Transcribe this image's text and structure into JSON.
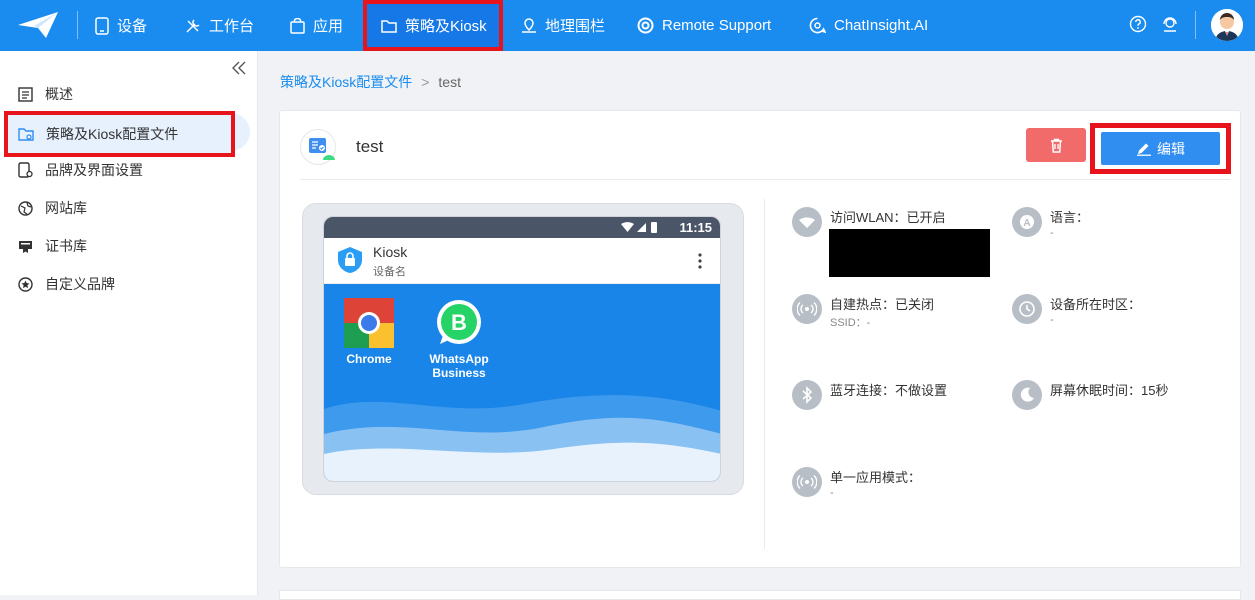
{
  "topnav": {
    "items": [
      {
        "label": "设备",
        "icon": "tablet-icon"
      },
      {
        "label": "工作台",
        "icon": "tools-icon"
      },
      {
        "label": "应用",
        "icon": "app-bag-icon"
      },
      {
        "label": "策略及Kiosk",
        "icon": "folder-icon"
      },
      {
        "label": "地理围栏",
        "icon": "map-pin-icon"
      },
      {
        "label": "Remote Support",
        "icon": "lifebuoy-icon"
      },
      {
        "label": "ChatInsight.AI",
        "icon": "chat-ai-icon"
      }
    ],
    "active_index": 3,
    "accent": "#1a8cf0",
    "highlight": "#e8141c"
  },
  "sidebar": {
    "items": [
      {
        "label": "概述",
        "icon": "overview-icon"
      },
      {
        "label": "策略及Kiosk配置文件",
        "icon": "folder-config-icon"
      },
      {
        "label": "品牌及界面设置",
        "icon": "brand-device-icon"
      },
      {
        "label": "网站库",
        "icon": "web-library-icon"
      },
      {
        "label": "证书库",
        "icon": "certificate-icon"
      },
      {
        "label": "自定义品牌",
        "icon": "star-icon"
      }
    ],
    "active_index": 1
  },
  "breadcrumb": {
    "parent": "策略及Kiosk配置文件",
    "separator": ">",
    "current": "test"
  },
  "profile": {
    "title": "test",
    "edit_label": "编辑"
  },
  "device": {
    "time": "11:15",
    "app_title": "Kiosk",
    "app_subtitle": "设备名",
    "apps": [
      {
        "label": "Chrome",
        "icon": "chrome-icon"
      },
      {
        "label": "WhatsApp Business",
        "label_line1": "WhatsApp",
        "label_line2": "Business",
        "icon": "whatsapp-business-icon"
      }
    ]
  },
  "settings": [
    {
      "label": "访问WLAN：已开启",
      "value": "",
      "icon": "wifi-icon"
    },
    {
      "label": "语言：",
      "value": "-",
      "icon": "language-icon"
    },
    {
      "label": "自建热点：已关闭",
      "value": "SSID：-",
      "icon": "hotspot-icon"
    },
    {
      "label": "设备所在时区：",
      "value": "-",
      "icon": "clock-icon"
    },
    {
      "label": "蓝牙连接：不做设置",
      "value": "",
      "icon": "bluetooth-icon"
    },
    {
      "label": "屏幕休眠时间：15秒",
      "value": "",
      "icon": "moon-icon"
    },
    {
      "label": "单一应用模式：",
      "value": "-",
      "icon": "single-app-icon"
    }
  ]
}
